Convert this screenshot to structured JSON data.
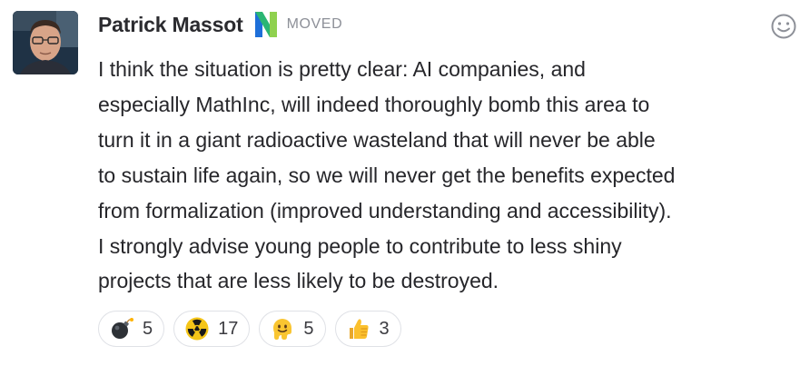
{
  "message": {
    "sender": {
      "name": "Patrick Massot",
      "badge_icon": "n-logo-icon",
      "status": "MOVED"
    },
    "lines": [
      "I think the situation is pretty clear: AI companies, and",
      "especially MathInc, will indeed thoroughly bomb this area to",
      "turn it in a giant radioactive wasteland that will never be able",
      "to sustain life again, so we will never get the benefits expected",
      "from formalization (improved understanding and accessibility).",
      "I strongly advise young people to contribute to less shiny",
      "projects that are less likely to be destroyed."
    ],
    "reactions": [
      {
        "icon": "bomb-icon",
        "count": "5"
      },
      {
        "icon": "radioactive-icon",
        "count": "17"
      },
      {
        "icon": "melting-face-icon",
        "count": "5"
      },
      {
        "icon": "thumbs-up-icon",
        "count": "3"
      }
    ],
    "add_reaction_icon": "smiley-icon"
  },
  "colors": {
    "text": "#26262a",
    "muted": "#8d9098",
    "badge_green": "#2bb673",
    "badge_blue": "#1e6fd9",
    "pill_border": "#dfe1e6"
  }
}
